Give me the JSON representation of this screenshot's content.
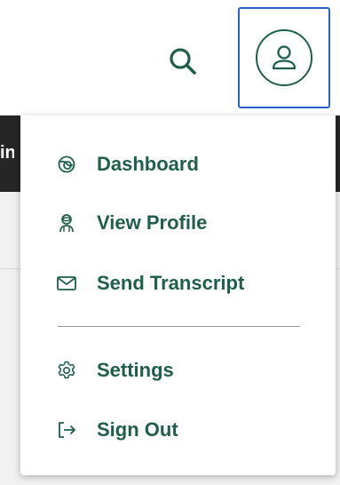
{
  "colors": {
    "accent": "#1f5f4a",
    "focus_ring": "#2a60c8",
    "dark_bar": "#262626",
    "panel": "#f1f1f1"
  },
  "header": {
    "search_icon": "search-icon",
    "account_icon": "user-icon"
  },
  "background": {
    "partial_text": "in"
  },
  "menu": {
    "items": [
      {
        "label": "Dashboard",
        "icon": "dashboard-icon"
      },
      {
        "label": "View Profile",
        "icon": "profile-icon"
      },
      {
        "label": "Send Transcript",
        "icon": "mail-icon"
      },
      {
        "label": "Settings",
        "icon": "gear-icon"
      },
      {
        "label": "Sign Out",
        "icon": "sign-out-icon"
      }
    ]
  }
}
